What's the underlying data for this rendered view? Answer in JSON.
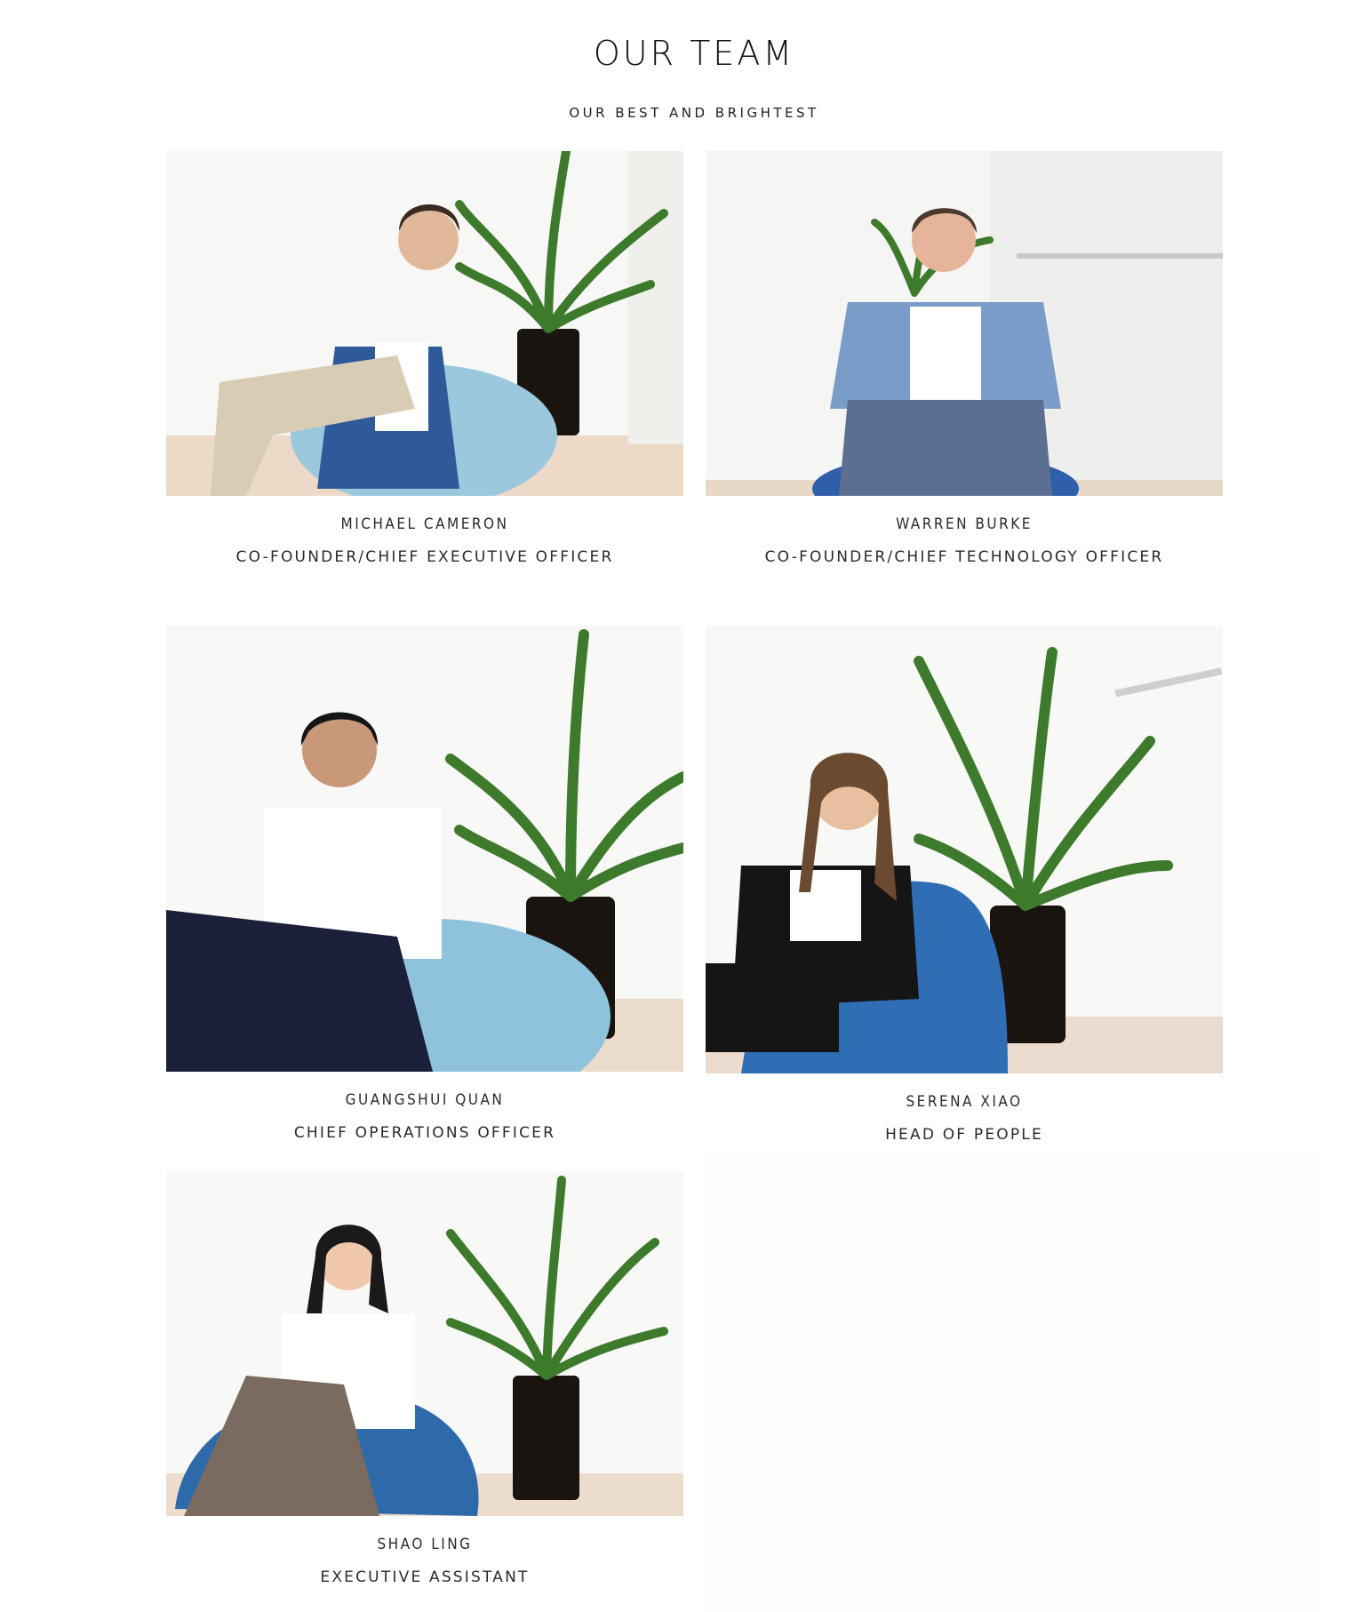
{
  "header": {
    "title": "OUR TEAM",
    "subtitle": "OUR BEST AND BRIGHTEST"
  },
  "members": [
    {
      "name": "MICHAEL CAMERON",
      "role": "CO-FOUNDER/CHIEF EXECUTIVE OFFICER",
      "photo": {
        "beanbag_color": "#9cc8de",
        "shirt": "#ffffff",
        "jacket": "#2f5a9a",
        "pants": "#d8cdb4",
        "hair": "#3a2a20"
      }
    },
    {
      "name": "WARREN BURKE",
      "role": "CO-FOUNDER/CHIEF TECHNOLOGY OFFICER",
      "photo": {
        "beanbag_color": "#2f5fa8",
        "shirt": "#ffffff",
        "jacket": "#7a9cc8",
        "pants": "#5c6f90",
        "hair": "#4a3a30"
      }
    },
    {
      "name": "GUANGSHUI QUAN",
      "role": "CHIEF OPERATIONS OFFICER",
      "photo": {
        "beanbag_color": "#8fc3dc",
        "shirt": "#ffffff",
        "jacket": "#ffffff",
        "pants": "#1b1f3a",
        "hair": "#151515"
      }
    },
    {
      "name": "SERENA XIAO",
      "role": "HEAD OF PEOPLE",
      "photo": {
        "beanbag_color": "#2f6db5",
        "shirt": "#ffffff",
        "jacket": "#151515",
        "pants": "#151515",
        "hair": "#6a4a30"
      }
    },
    {
      "name": "SHAO LING",
      "role": "EXECUTIVE ASSISTANT",
      "photo": {
        "beanbag_color": "#2e6aaa",
        "shirt": "#ffffff",
        "jacket": "#ffffff",
        "pants": "#7a6a60",
        "hair": "#1a1a1a"
      }
    }
  ]
}
